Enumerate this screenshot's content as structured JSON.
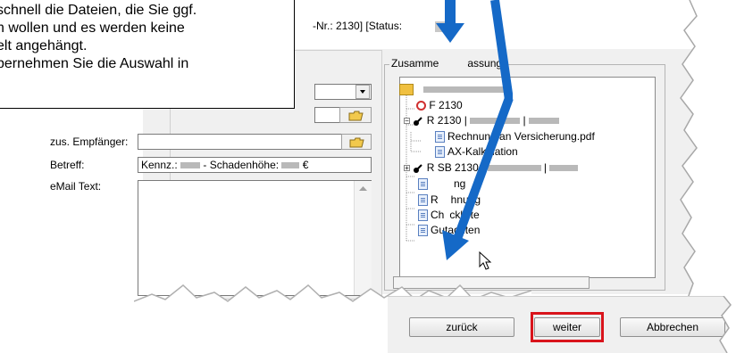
{
  "window": {
    "title_fragment": "-Nr.: 2130]  [Status: "
  },
  "tooltip": {
    "lines": [
      "schnell die Dateien, die Sie ggf.",
      "n wollen und es werden keine",
      "elt angehängt.",
      "bernehmen Sie die Auswahl in"
    ]
  },
  "form": {
    "cc_label": "zus. Empfänger:",
    "subject_label": "Betreff:",
    "subject_prefix": "Kennz.: ",
    "subject_middle": " - Schadenhöhe: ",
    "subject_suffix": " €",
    "body_label": "eMail Text:"
  },
  "summary": {
    "title": "Zusammenfassung",
    "title_start": "Zusamme",
    "title_end": "assung",
    "items": {
      "item1": "2130",
      "item1_prefix": "F",
      "item2": "2130  |",
      "item2_prefix": "R",
      "item2_sep": "|",
      "item3": "Rechnung an Versicherung.pdf",
      "item4": "AX-Kalkulation",
      "item5": "SB 2130  |",
      "item5_prefix": "R",
      "item5_sep": "|",
      "item6": "ng",
      "item7": "hnung",
      "item7_prefix": "R",
      "item8": "Checkliste",
      "item8_a": "Ch",
      "item8_b": "ckliste",
      "item9": "Gutachten"
    }
  },
  "buttons": {
    "back": "zurück",
    "next": "weiter",
    "cancel": "Abbrechen"
  },
  "colors": {
    "arrow": "#1569c7",
    "highlight": "#d9141c"
  }
}
